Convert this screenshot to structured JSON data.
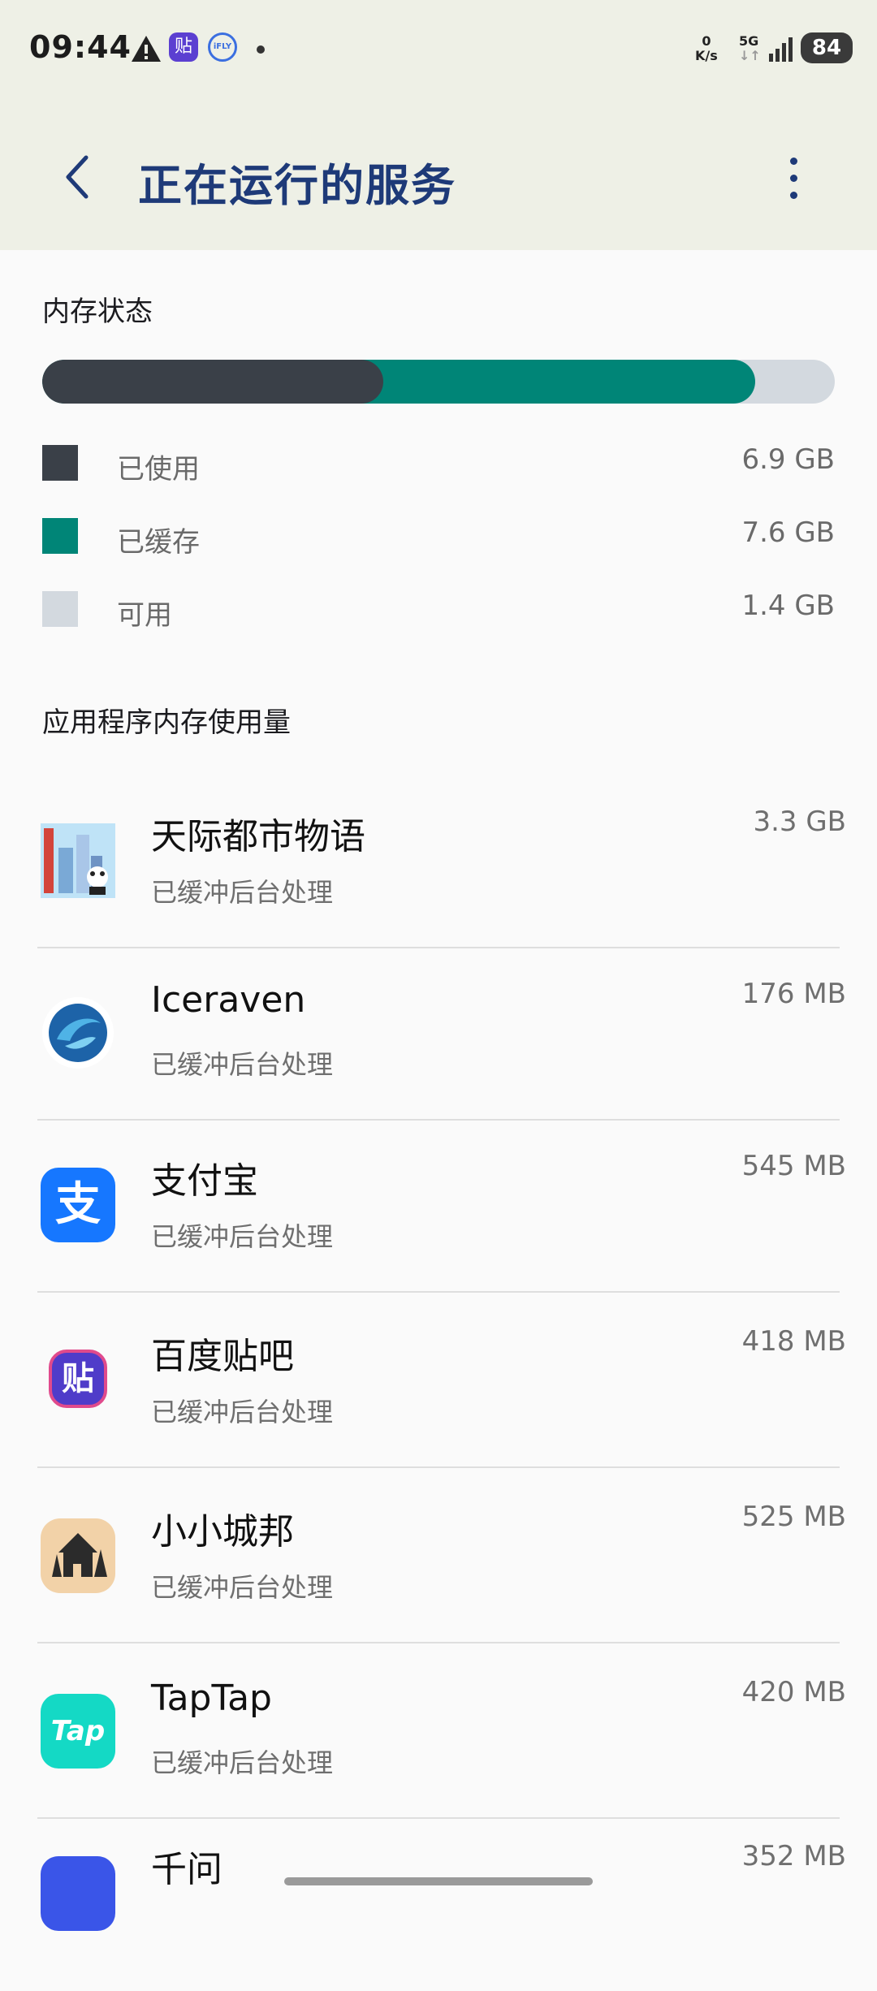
{
  "status_bar": {
    "time": "09:44",
    "net_speed_value": "0",
    "net_speed_unit": "K/s",
    "network_type": "5G",
    "battery": "84",
    "icons": [
      "warning-icon",
      "tieba-notification-icon",
      "ifly-notification-icon",
      "more-notifications-dot",
      "signal-icon",
      "battery-icon"
    ]
  },
  "header": {
    "title": "正在运行的服务",
    "back_icon": "back-arrow-icon",
    "more_icon": "more-vert-icon"
  },
  "memory": {
    "section_title": "内存状态",
    "used": {
      "label": "已使用",
      "value": "6.9 GB",
      "color": "#3a4048"
    },
    "cached": {
      "label": "已缓存",
      "value": "7.6 GB",
      "color": "#008577"
    },
    "free": {
      "label": "可用",
      "value": "1.4 GB",
      "color": "#d3d9df"
    },
    "bar_fractions": {
      "used": 0.43,
      "cached": 0.47,
      "free": 0.1
    }
  },
  "apps_section_title": "应用程序内存使用量",
  "apps": [
    {
      "name": "天际都市物语",
      "status": "已缓冲后台处理",
      "size": "3.3 GB",
      "icon": "skyline-city-app-icon"
    },
    {
      "name": "Iceraven",
      "status": "已缓冲后台处理",
      "size": "176 MB",
      "icon": "iceraven-app-icon"
    },
    {
      "name": "支付宝",
      "status": "已缓冲后台处理",
      "size": "545 MB",
      "icon": "alipay-app-icon",
      "icon_text": "支"
    },
    {
      "name": "百度贴吧",
      "status": "已缓冲后台处理",
      "size": "418 MB",
      "icon": "baidu-tieba-app-icon",
      "icon_text": "贴"
    },
    {
      "name": "小小城邦",
      "status": "已缓冲后台处理",
      "size": "525 MB",
      "icon": "tiny-city-app-icon"
    },
    {
      "name": "TapTap",
      "status": "已缓冲后台处理",
      "size": "420 MB",
      "icon": "taptap-app-icon",
      "icon_text": "Tap"
    },
    {
      "name": "千问",
      "status": "",
      "size": "352 MB",
      "icon": "qianwen-app-icon"
    }
  ]
}
